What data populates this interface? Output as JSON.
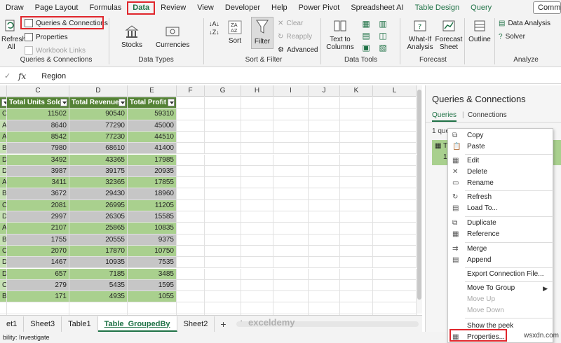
{
  "ribbon_tabs": [
    {
      "label": "Draw"
    },
    {
      "label": "Page Layout"
    },
    {
      "label": "Formulas"
    },
    {
      "label": "Data"
    },
    {
      "label": "Review"
    },
    {
      "label": "View"
    },
    {
      "label": "Developer"
    },
    {
      "label": "Help"
    },
    {
      "label": "Power Pivot"
    },
    {
      "label": "Spreadsheet AI"
    },
    {
      "label": "Table Design"
    },
    {
      "label": "Query"
    }
  ],
  "comment_button": "Comm",
  "ribbon": {
    "refresh_all": "Refresh All",
    "queries_connections": "Queries & Connections",
    "properties": "Properties",
    "workbook_links": "Workbook Links",
    "group_queries": "Queries & Connections",
    "stocks": "Stocks",
    "currencies": "Currencies",
    "group_data_types": "Data Types",
    "sort": "Sort",
    "filter": "Filter",
    "clear": "Clear",
    "reapply": "Reapply",
    "advanced": "Advanced",
    "group_sort_filter": "Sort & Filter",
    "text_to_columns": "Text to Columns",
    "group_data_tools": "Data Tools",
    "what_if": "What-If Analysis",
    "forecast_sheet": "Forecast Sheet",
    "group_forecast": "Forecast",
    "outline": "Outline",
    "data_analysis": "Data Analysis",
    "solver": "Solver",
    "group_analyze": "Analyze"
  },
  "formula_bar": {
    "fx": "fx",
    "value": "Region"
  },
  "grid": {
    "columns": [
      "C",
      "D",
      "E",
      "F",
      "G",
      "H",
      "I",
      "J",
      "K",
      "L"
    ],
    "headers": [
      "Total Units Sold",
      "Total Revenue",
      "Total Profit"
    ],
    "rows": [
      [
        "C",
        "11502",
        "90540",
        "59310"
      ],
      [
        "A",
        "8640",
        "77290",
        "45000"
      ],
      [
        "A",
        "8542",
        "77230",
        "44510"
      ],
      [
        "B",
        "7980",
        "68610",
        "41400"
      ],
      [
        "D",
        "3492",
        "43365",
        "17985"
      ],
      [
        "D",
        "3987",
        "39175",
        "20935"
      ],
      [
        "A",
        "3411",
        "32365",
        "17855"
      ],
      [
        "B",
        "3672",
        "29430",
        "18960"
      ],
      [
        "C",
        "2081",
        "26995",
        "11205"
      ],
      [
        "D",
        "2997",
        "26305",
        "15585"
      ],
      [
        "A",
        "2107",
        "25865",
        "10835"
      ],
      [
        "B",
        "1755",
        "20555",
        "9375"
      ],
      [
        "C",
        "2070",
        "17870",
        "10750"
      ],
      [
        "D",
        "1467",
        "10935",
        "7535"
      ],
      [
        "D",
        "657",
        "7185",
        "3485"
      ],
      [
        "C",
        "279",
        "5435",
        "1595"
      ],
      [
        "B",
        "171",
        "4935",
        "1055"
      ]
    ]
  },
  "sheet_tabs": [
    "et1",
    "Sheet3",
    "Table1",
    "Table_GroupedBy",
    "Sheet2"
  ],
  "active_sheet": "Table_GroupedBy",
  "status_text": "bility: Investigate",
  "panel": {
    "title": "Queries & Connections",
    "tab_queries": "Queries",
    "tab_connections": "Connections",
    "query_count": "1 quer",
    "item_letter": "T",
    "item_line2": "1"
  },
  "context_menu": [
    {
      "label": "Copy",
      "icon": "copy-icon",
      "enabled": true
    },
    {
      "label": "Paste",
      "icon": "paste-icon",
      "enabled": true
    },
    {
      "label": "Edit",
      "icon": "edit-icon",
      "enabled": true
    },
    {
      "label": "Delete",
      "icon": "delete-icon",
      "enabled": true
    },
    {
      "label": "Rename",
      "icon": "rename-icon",
      "enabled": true
    },
    {
      "label": "Refresh",
      "icon": "refresh-icon",
      "enabled": true
    },
    {
      "label": "Load To...",
      "icon": "load-icon",
      "enabled": true
    },
    {
      "label": "Duplicate",
      "icon": "duplicate-icon",
      "enabled": true
    },
    {
      "label": "Reference",
      "icon": "reference-icon",
      "enabled": true
    },
    {
      "label": "Merge",
      "icon": "merge-icon",
      "enabled": true
    },
    {
      "label": "Append",
      "icon": "append-icon",
      "enabled": true
    },
    {
      "label": "Export Connection File...",
      "icon": "",
      "enabled": true
    },
    {
      "label": "Move To Group",
      "icon": "",
      "enabled": true
    },
    {
      "label": "Move Up",
      "icon": "",
      "enabled": false
    },
    {
      "label": "Move Down",
      "icon": "",
      "enabled": false
    },
    {
      "label": "Show the peek",
      "icon": "",
      "enabled": true
    },
    {
      "label": "Properties...",
      "icon": "properties-icon",
      "enabled": true
    }
  ],
  "watermark": "wsxdn.com",
  "logo_text": "exceldemy",
  "colors": {
    "accent": "#1e7145",
    "highlight": "#e0262c",
    "table_header": "#548235",
    "band_a": "#a9d08e",
    "band_b": "#c6e0b4"
  }
}
